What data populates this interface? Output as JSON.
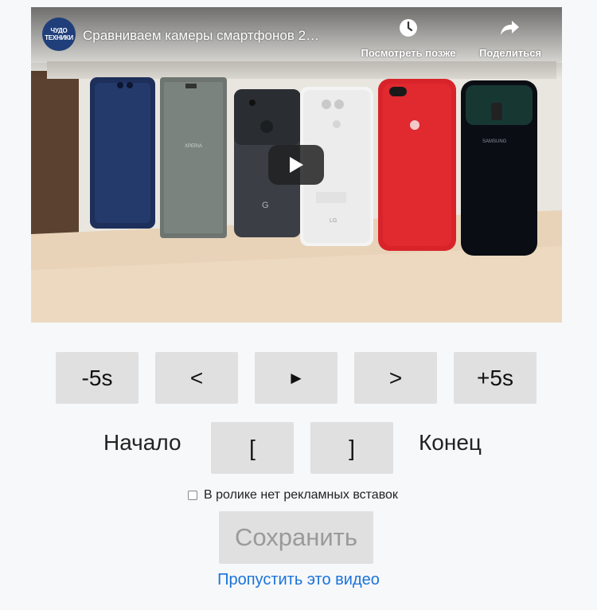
{
  "video": {
    "channel_logo_text": "ЧУДО ТЕХНИКИ",
    "title": "Сравниваем камеры смартфонов 2…",
    "watch_later_label": "Посмотреть позже",
    "share_label": "Поделиться",
    "phone_brand_texts": [
      "XPERIA",
      "G",
      "LG",
      "SAMSUNG"
    ]
  },
  "controls": {
    "back5": "-5s",
    "prev": "<",
    "play": "►",
    "next": ">",
    "fwd5": "+5s",
    "start_label": "Начало",
    "mark_start": "[",
    "mark_end": "]",
    "end_label": "Конец"
  },
  "no_ads_checkbox": {
    "label": "В ролике нет рекламных вставок",
    "checked": false
  },
  "save_label": "Сохранить",
  "skip_link": "Пропустить это видео",
  "colors": {
    "background": "#f7f8fa",
    "button_bg": "#e0e0e0",
    "link": "#1a73d9",
    "disabled_text": "#9a9a9a"
  }
}
